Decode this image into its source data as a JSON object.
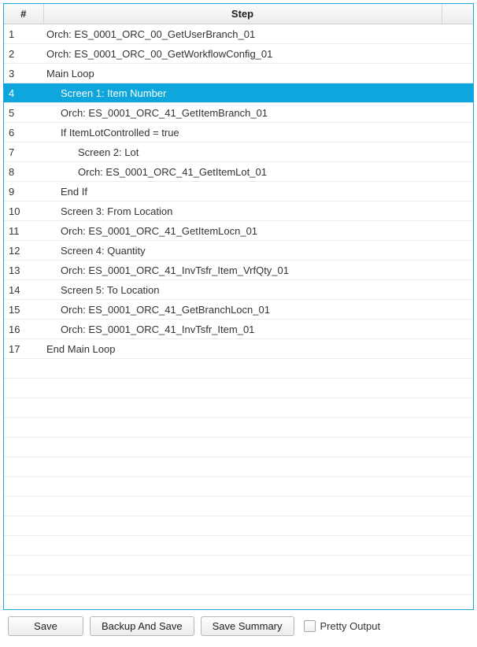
{
  "table": {
    "headers": {
      "num": "#",
      "step": "Step",
      "extra": ""
    },
    "rows": [
      {
        "num": "1",
        "step": "Orch: ES_0001_ORC_00_GetUserBranch_01",
        "indent": 0,
        "selected": false
      },
      {
        "num": "2",
        "step": "Orch: ES_0001_ORC_00_GetWorkflowConfig_01",
        "indent": 0,
        "selected": false
      },
      {
        "num": "3",
        "step": "Main Loop",
        "indent": 0,
        "selected": false
      },
      {
        "num": "4",
        "step": "Screen 1: Item Number",
        "indent": 1,
        "selected": true
      },
      {
        "num": "5",
        "step": "Orch: ES_0001_ORC_41_GetItemBranch_01",
        "indent": 1,
        "selected": false
      },
      {
        "num": "6",
        "step": "If ItemLotControlled = true",
        "indent": 1,
        "selected": false
      },
      {
        "num": "7",
        "step": "Screen 2: Lot",
        "indent": 2,
        "selected": false
      },
      {
        "num": "8",
        "step": "Orch: ES_0001_ORC_41_GetItemLot_01",
        "indent": 2,
        "selected": false
      },
      {
        "num": "9",
        "step": "End If",
        "indent": 1,
        "selected": false
      },
      {
        "num": "10",
        "step": "Screen 3: From Location",
        "indent": 1,
        "selected": false
      },
      {
        "num": "11",
        "step": "Orch: ES_0001_ORC_41_GetItemLocn_01",
        "indent": 1,
        "selected": false
      },
      {
        "num": "12",
        "step": "Screen 4: Quantity",
        "indent": 1,
        "selected": false
      },
      {
        "num": "13",
        "step": "Orch: ES_0001_ORC_41_InvTsfr_Item_VrfQty_01",
        "indent": 1,
        "selected": false
      },
      {
        "num": "14",
        "step": "Screen 5: To Location",
        "indent": 1,
        "selected": false
      },
      {
        "num": "15",
        "step": "Orch: ES_0001_ORC_41_GetBranchLocn_01",
        "indent": 1,
        "selected": false
      },
      {
        "num": "16",
        "step": "Orch: ES_0001_ORC_41_InvTsfr_Item_01",
        "indent": 1,
        "selected": false
      },
      {
        "num": "17",
        "step": "End Main Loop",
        "indent": 0,
        "selected": false
      }
    ],
    "empty_rows": 12
  },
  "buttons": {
    "save": "Save",
    "backup_save": "Backup And Save",
    "save_summary": "Save Summary"
  },
  "checkbox": {
    "pretty_output_label": "Pretty Output",
    "pretty_output_checked": false
  }
}
